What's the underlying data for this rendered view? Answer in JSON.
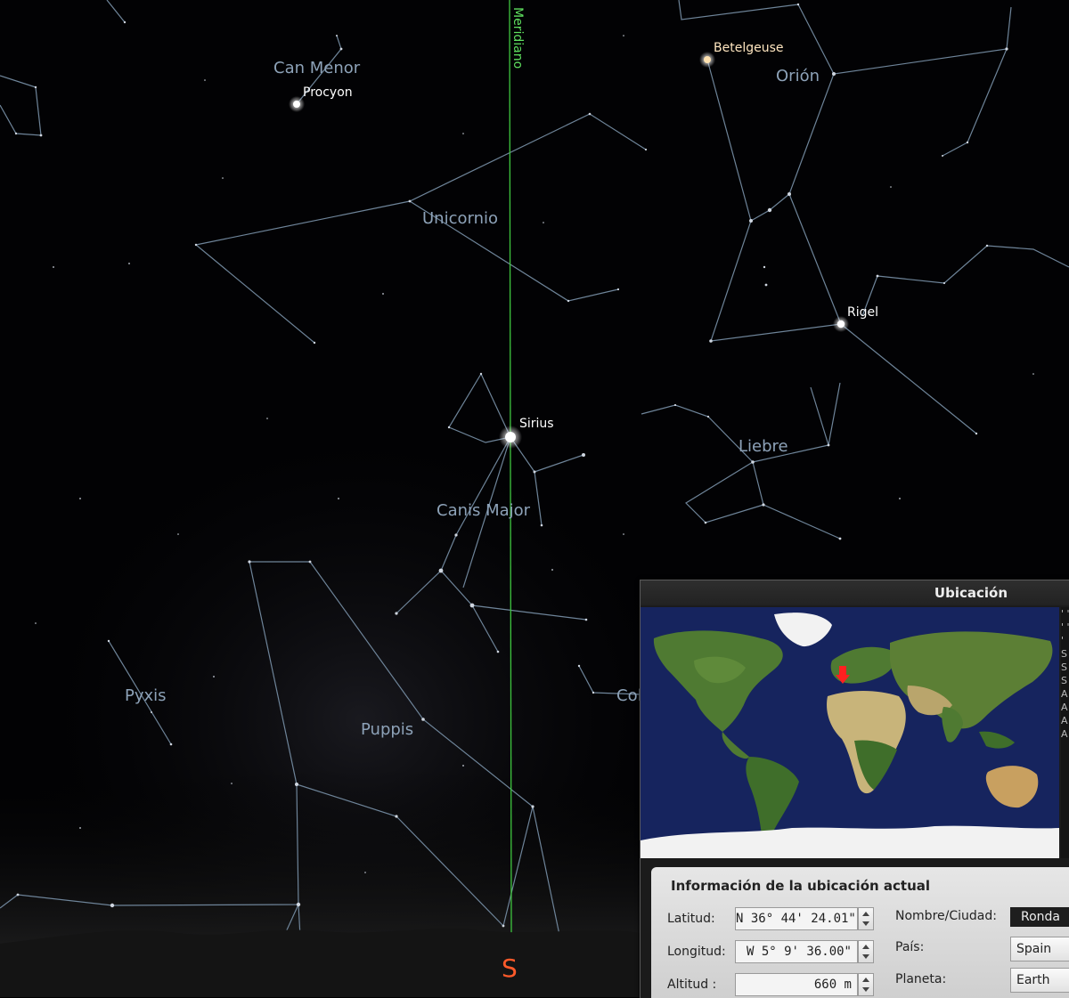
{
  "sky": {
    "constellations": [
      "Can Menor",
      "Unicornio",
      "Orión",
      "Liebre",
      "Canis Major",
      "Pyxis",
      "Puppis",
      "Columba"
    ],
    "stars": [
      "Procyon",
      "Betelgeuse",
      "Rigel",
      "Sirius"
    ],
    "meridian_label": "Meridiano",
    "cardinal": "S"
  },
  "location_window": {
    "title": "Ubicación",
    "list_glyphs": "' ' ' ' ' S S S A A A A",
    "info_title": "Información de la ubicación actual",
    "latitude_label": "Latitud:",
    "latitude_value": "N 36° 44' 24.01\"",
    "longitude_label": "Longitud:",
    "longitude_value": "W 5° 9' 36.00\"",
    "altitude_label": "Altitud :",
    "altitude_value": "660 m",
    "name_label": "Nombre/Ciudad:",
    "name_value": "Ronda",
    "country_label": "País:",
    "country_value": "Spain",
    "planet_label": "Planeta:",
    "planet_value": "Earth"
  },
  "colors": {
    "constellation_line": "#6e8499",
    "meridian": "#3fc63f",
    "cardinal": "#ff5a2a",
    "ocean": "#16245e",
    "land": "#4f7a32",
    "desert": "#c8b47a",
    "ice": "#f2f2f2",
    "marker": "#ff2020"
  }
}
